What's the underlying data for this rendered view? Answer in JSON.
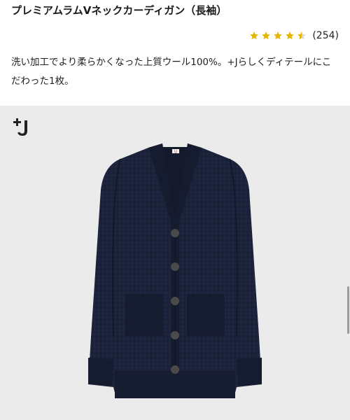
{
  "product": {
    "title": "プレミアムラムVネックカーディガン（長袖）",
    "rating_value": 4.5,
    "review_count": "(254)",
    "description": "洗い加工でより柔らかくなった上質ウール100%。+Jらしくディテールにこだわった1枚。",
    "image": {
      "brand_logo": "+J",
      "garment_label": "U",
      "colors": {
        "background": "#ebebeb",
        "garment": "#1a2035",
        "button": "#4a4a4a"
      },
      "button_count": 5
    }
  },
  "colors": {
    "star": "#e8b400",
    "star_empty": "#d9d9d9"
  },
  "icons": {
    "star": "star-icon",
    "half_star": "half-star-icon"
  }
}
